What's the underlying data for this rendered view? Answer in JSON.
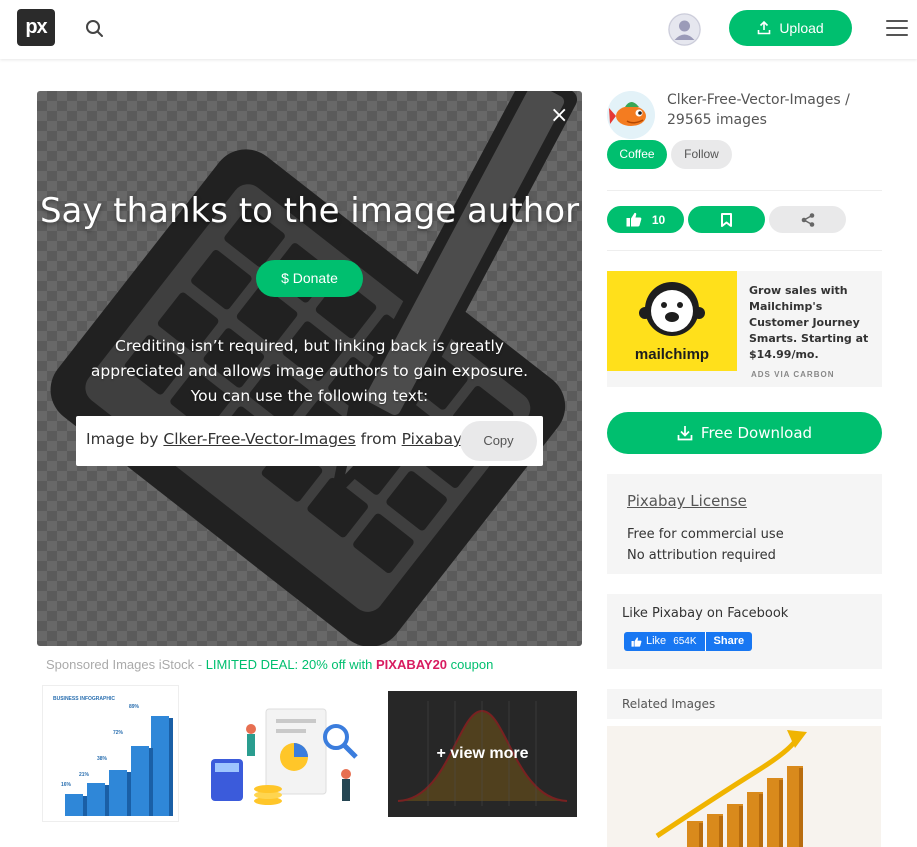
{
  "header": {
    "logo_text": "px",
    "upload_label": "Upload"
  },
  "overlay": {
    "title": "Say thanks to the image author",
    "donate_label": "$ Donate",
    "credit_text": "Crediting isn’t required, but linking back is greatly appreciated and allows image authors to gain exposure. You can use the following text:",
    "credit_prefix": "Image by",
    "credit_author": "Clker-Free-Vector-Images",
    "credit_from": "from",
    "credit_site": "Pixabay",
    "copy_label": "Copy",
    "close_symbol": "×"
  },
  "sponsored": {
    "prefix": "Sponsored Images iStock - ",
    "deal": "LIMITED DEAL: 20% off with ",
    "code": "PIXABAY20",
    "suffix": " coupon",
    "view_more": "+ view more",
    "chart_labels": [
      "BUSINESS INFOGRAPHIC",
      "89%",
      "72%",
      "38%",
      "21%",
      "16%"
    ]
  },
  "author": {
    "name": "Clker-Free-Vector-Images",
    "images": "29565 images",
    "separator": " / ",
    "coffee_label": "Coffee",
    "follow_label": "Follow"
  },
  "actions": {
    "like_count": "10"
  },
  "ad": {
    "brand": "mailchimp",
    "text": "Grow sales with Mailchimp's Customer Journey Smarts. Starting at $14.99/mo.",
    "via": "ADS VIA CARBON"
  },
  "download_label": "Free Download",
  "license": {
    "title": "Pixabay License",
    "line1": "Free for commercial use",
    "line2": "No attribution required"
  },
  "facebook": {
    "title": "Like Pixabay on Facebook",
    "like_label": "Like",
    "like_count": "654K",
    "share_label": "Share"
  },
  "related": {
    "title": "Related Images"
  },
  "colors": {
    "accent": "#00bf6f",
    "coupon": "#d81b60",
    "facebook": "#1877f2"
  }
}
